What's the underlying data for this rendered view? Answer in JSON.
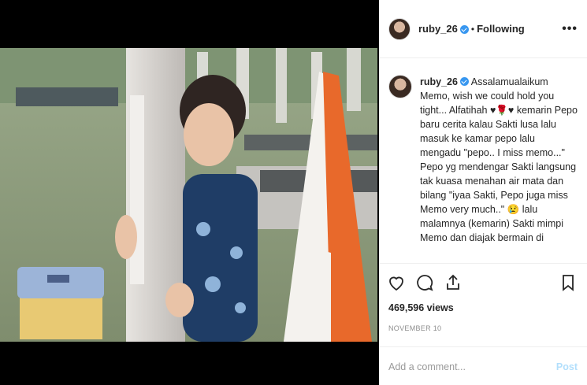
{
  "header": {
    "username": "ruby_26",
    "separator": "•",
    "follow_label": "Following",
    "more_label": "•••"
  },
  "caption": {
    "username": "ruby_26",
    "text": "Assalamualaikum Memo, wish we could hold you tight... Alfatihah ♥🌹♥ kemarin Pepo baru cerita kalau Sakti lusa lalu masuk ke kamar pepo lalu mengadu \"pepo.. I miss memo...\" Pepo yg mendengar Sakti langsung tak kuasa menahan air mata dan bilang \"iyaa Sakti, Pepo juga miss Memo very much..\" 😢 lalu malamnya (kemarin) Sakti mimpi Memo dan diajak bermain di"
  },
  "actions": {
    "icons": [
      "heart-icon",
      "comment-icon",
      "share-icon",
      "bookmark-icon"
    ]
  },
  "stats": {
    "views": "469,596 views",
    "date": "NOVEMBER 10"
  },
  "comment_box": {
    "placeholder": "Add a comment...",
    "post_label": "Post"
  },
  "colors": {
    "verified": "#3897f0",
    "post_disabled": "#b2dffc",
    "flag_red": "#e8692b",
    "flag_white": "#f4f2ee"
  }
}
